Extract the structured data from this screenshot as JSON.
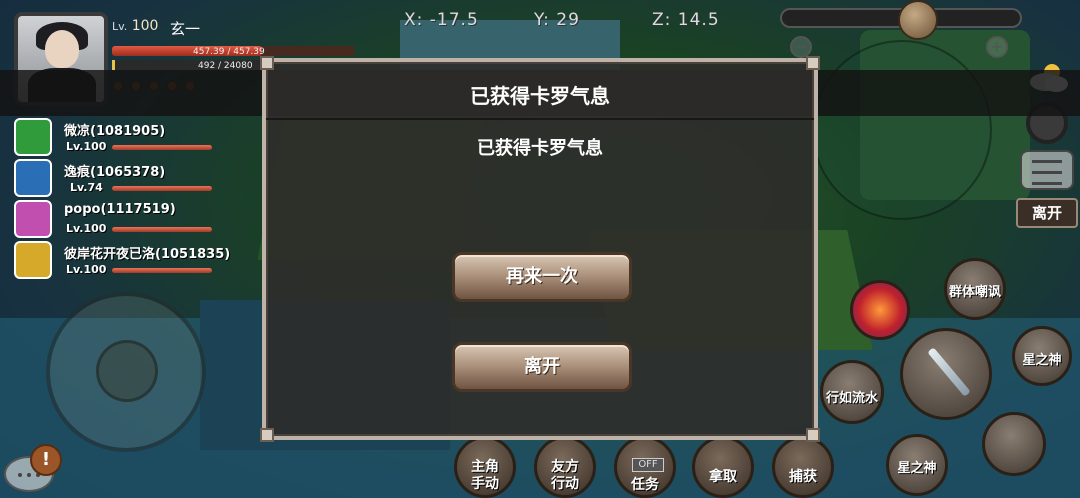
{
  "player": {
    "level_prefix": "Lv.",
    "level": "100",
    "name": "玄一",
    "hp_text": "457.39 / 457.39",
    "xp_text": "492 / 24080"
  },
  "coords": {
    "x": "X: -17.5",
    "y": "Y: 29",
    "z": "Z: 14.5"
  },
  "zoom": {
    "out": "−",
    "in": "+"
  },
  "top_leave_label": "离开",
  "team": [
    {
      "name": "微凉(1081905)",
      "level": "Lv.100",
      "avatar_color": "#2f9b3a",
      "hp": 1.0
    },
    {
      "name": "逸痕(1065378)",
      "level": "Lv.74",
      "avatar_color": "#2a6fb5",
      "hp": 1.0
    },
    {
      "name": "popo(1117519)",
      "level": "Lv.100",
      "avatar_color": "#c04fb0",
      "hp": 1.0
    },
    {
      "name": "彼岸花开夜已洛(1051835)",
      "level": "Lv.100",
      "avatar_color": "#d6a92a",
      "hp": 1.0
    }
  ],
  "dialog": {
    "title": "已获得卡罗气息",
    "message": "已获得卡罗气息",
    "retry_label": "再来一次",
    "leave_label": "离开"
  },
  "actions": {
    "role": "主角\n手动",
    "ally": "友方\n行动",
    "task": "任务",
    "task_badge": "OFF",
    "take": "拿取",
    "capture": "捕获"
  },
  "skills": {
    "taunt": "群体嘲讽",
    "flow": "行如流水",
    "star1": "星之神",
    "star2": "星之神"
  },
  "alert": "!",
  "colors": {
    "accent": "#a88e78",
    "dialog_bg": "#2e2c2a",
    "hp": "#e05b43"
  }
}
